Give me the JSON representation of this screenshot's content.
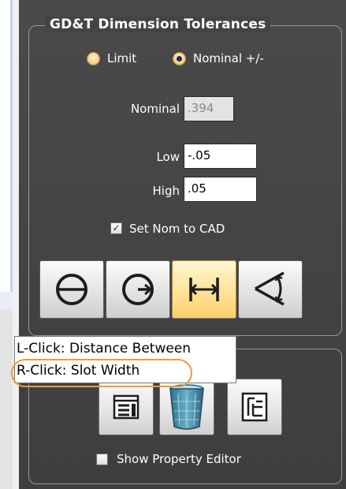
{
  "app": {
    "group_title": "GD&T Dimension Tolerances"
  },
  "tolerance_mode": {
    "options": [
      {
        "label": "Limit",
        "checked": false
      },
      {
        "label": "Nominal +/-",
        "checked": true
      }
    ]
  },
  "fields": {
    "nominal": {
      "label": "Nominal",
      "value": ".394",
      "disabled": true
    },
    "low": {
      "label": "Low",
      "value": "-.05"
    },
    "high": {
      "label": "High",
      "value": ".05"
    }
  },
  "set_nom_to_cad": {
    "label": "Set Nom to CAD",
    "checked": true
  },
  "dimension_buttons": [
    {
      "icon": "diameter-icon",
      "active": false
    },
    {
      "icon": "radius-icon",
      "active": false
    },
    {
      "icon": "distance-between-icon",
      "active": true
    },
    {
      "icon": "angle-icon",
      "active": false
    }
  ],
  "tooltip": {
    "line1": "L-Click: Distance Between",
    "line2": "R-Click: Slot Width"
  },
  "tool_buttons": [
    {
      "icon": "property-list-icon"
    },
    {
      "icon": "trash-bin-icon"
    },
    {
      "icon": "tree-view-icon"
    }
  ],
  "show_property_editor": {
    "label": "Show Property Editor",
    "checked": false
  },
  "colors": {
    "panel_bg": "#444444",
    "active_button": "#ffe39a",
    "highlight_ring": "#ec9a3f"
  }
}
